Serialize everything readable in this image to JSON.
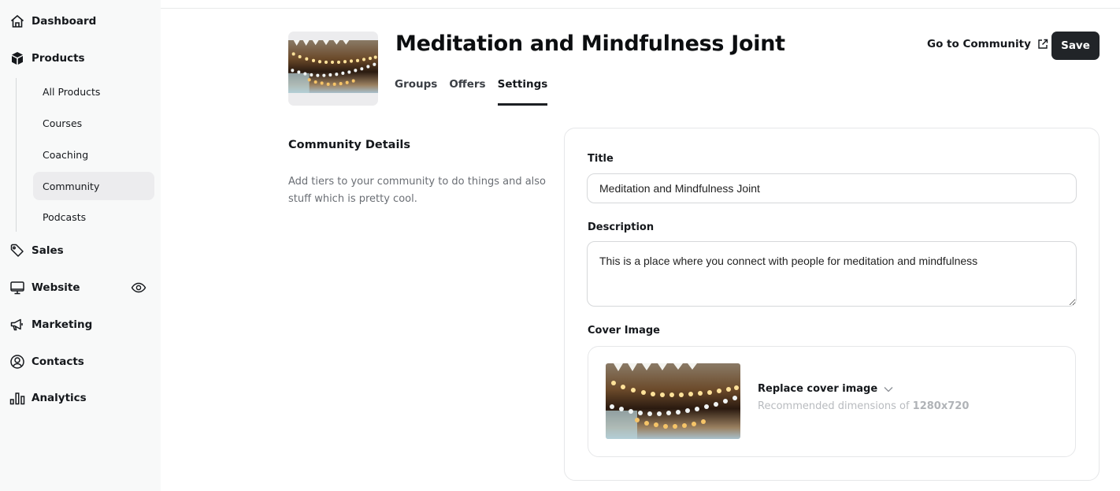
{
  "sidebar": {
    "items": [
      {
        "label": "Dashboard",
        "icon": "home-icon"
      },
      {
        "label": "Products",
        "icon": "box-icon"
      },
      {
        "label": "Sales",
        "icon": "tag-icon"
      },
      {
        "label": "Website",
        "icon": "monitor-icon"
      },
      {
        "label": "Marketing",
        "icon": "megaphone-icon"
      },
      {
        "label": "Contacts",
        "icon": "user-circle-icon"
      },
      {
        "label": "Analytics",
        "icon": "bar-chart-icon"
      }
    ],
    "products_sub": [
      {
        "label": "All Products"
      },
      {
        "label": "Courses"
      },
      {
        "label": "Coaching"
      },
      {
        "label": "Community",
        "active": true
      },
      {
        "label": "Podcasts"
      }
    ],
    "website_action_icon": "eye-icon"
  },
  "header": {
    "title": "Meditation and Mindfulness Joint",
    "tabs": [
      {
        "label": "Groups"
      },
      {
        "label": "Offers"
      },
      {
        "label": "Settings",
        "active": true
      }
    ],
    "go_to_community": "Go to Community",
    "save_label": "Save"
  },
  "details": {
    "heading": "Community Details",
    "description": "Add tiers to your community to do things and also stuff which is pretty cool."
  },
  "form": {
    "title_label": "Title",
    "title_value": "Meditation and Mindfulness Joint",
    "description_label": "Description",
    "description_value": "This is a place where you connect with people for meditation and mindfulness",
    "cover_label": "Cover Image",
    "replace_label": "Replace cover image",
    "recommended_prefix": "Recommended dimensions of ",
    "recommended_size": "1280x720"
  },
  "colors": {
    "sidebar_bg": "#f8f9f9",
    "primary_button": "#212428",
    "active_sub_bg": "#ececee"
  }
}
